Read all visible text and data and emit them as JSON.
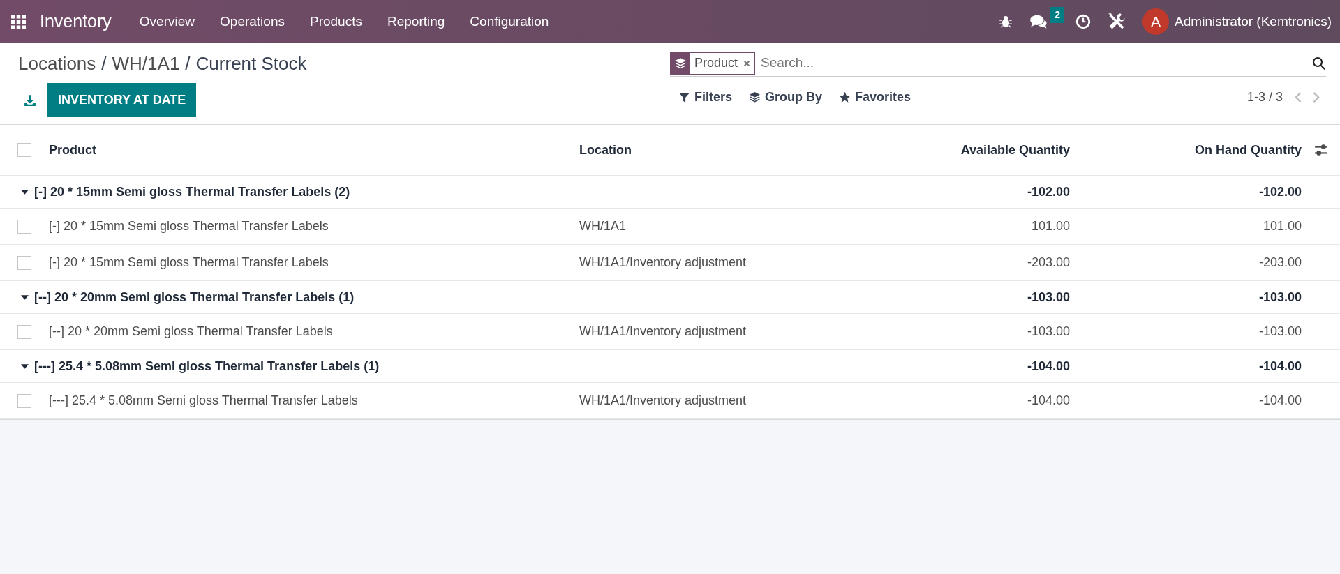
{
  "navbar": {
    "app": "Inventory",
    "menu": [
      "Overview",
      "Operations",
      "Products",
      "Reporting",
      "Configuration"
    ],
    "chat_count": "2",
    "avatar_letter": "A",
    "user": "Administrator (Kemtronics)"
  },
  "breadcrumb": {
    "separator": "/",
    "items": [
      "Locations",
      "WH/1A1",
      "Current Stock"
    ]
  },
  "primary_button": "INVENTORY AT DATE",
  "search": {
    "facet": "Product",
    "placeholder": "Search..."
  },
  "search_options": [
    {
      "kind": "filter",
      "label": "Filters"
    },
    {
      "kind": "layers",
      "label": "Group By"
    },
    {
      "kind": "star",
      "label": "Favorites"
    }
  ],
  "pager": "1-3 / 3",
  "table": {
    "select_all_checked": false,
    "columns": [
      "Product",
      "Location",
      "Available Quantity",
      "On Hand Quantity"
    ],
    "groups": [
      {
        "label": "[-] 20 * 15mm Semi gloss Thermal Transfer Labels (2)",
        "expanded": true,
        "available": "-102.00",
        "on_hand": "-102.00",
        "rows": [
          {
            "checked": false,
            "product": "[-] 20 * 15mm Semi gloss Thermal Transfer Labels",
            "location": "WH/1A1",
            "available": "101.00",
            "on_hand": "101.00"
          },
          {
            "checked": false,
            "product": "[-] 20 * 15mm Semi gloss Thermal Transfer Labels",
            "location": "WH/1A1/Inventory adjustment",
            "available": "-203.00",
            "on_hand": "-203.00"
          }
        ]
      },
      {
        "label": "[--] 20 * 20mm Semi gloss Thermal Transfer Labels (1)",
        "expanded": true,
        "available": "-103.00",
        "on_hand": "-103.00",
        "rows": [
          {
            "checked": false,
            "product": "[--] 20 * 20mm Semi gloss Thermal Transfer Labels",
            "location": "WH/1A1/Inventory adjustment",
            "available": "-103.00",
            "on_hand": "-103.00"
          }
        ]
      },
      {
        "label": "[---] 25.4 * 5.08mm Semi gloss Thermal Transfer Labels (1)",
        "expanded": true,
        "available": "-104.00",
        "on_hand": "-104.00",
        "rows": [
          {
            "checked": false,
            "product": "[---] 25.4 * 5.08mm Semi gloss Thermal Transfer Labels",
            "location": "WH/1A1/Inventory adjustment",
            "available": "-104.00",
            "on_hand": "-104.00"
          }
        ]
      }
    ]
  }
}
